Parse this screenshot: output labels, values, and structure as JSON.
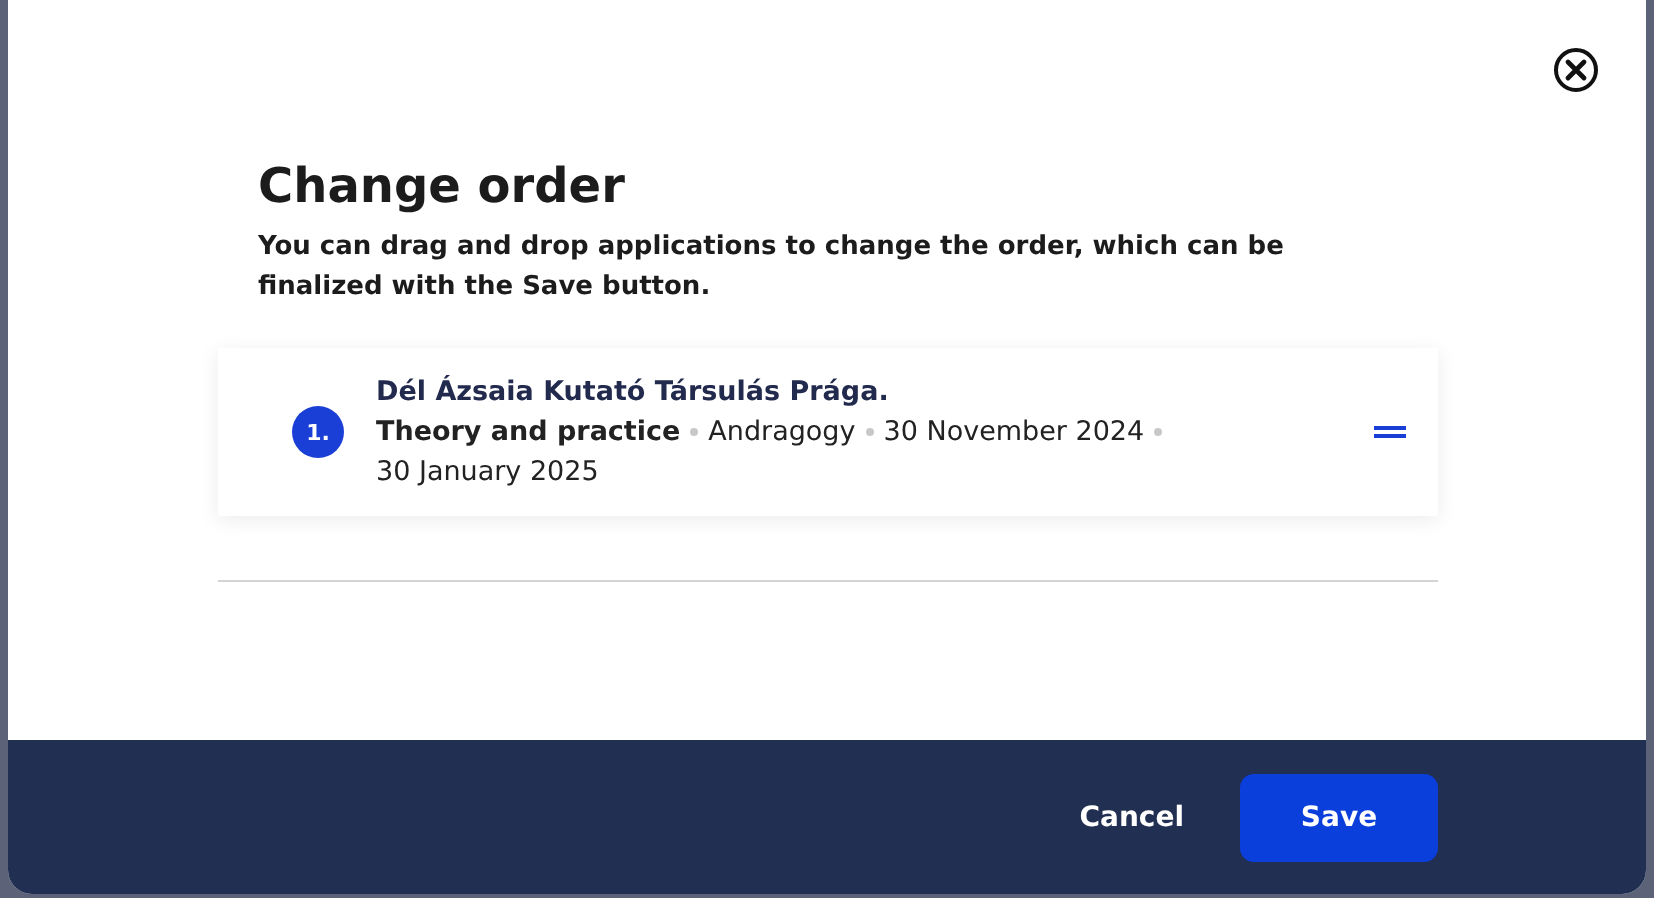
{
  "dialog": {
    "title": "Change order",
    "description": "You can drag and drop applications to change the order, which can be finalized with the Save button."
  },
  "items": [
    {
      "number": "1.",
      "title": "Dél Ázsaia Kutató Társulás Prága.",
      "subject": "Theory and practice",
      "meta": [
        "Andragogy",
        "30 November 2024",
        "30 January 2025"
      ]
    }
  ],
  "buttons": {
    "cancel": "Cancel",
    "save": "Save"
  }
}
